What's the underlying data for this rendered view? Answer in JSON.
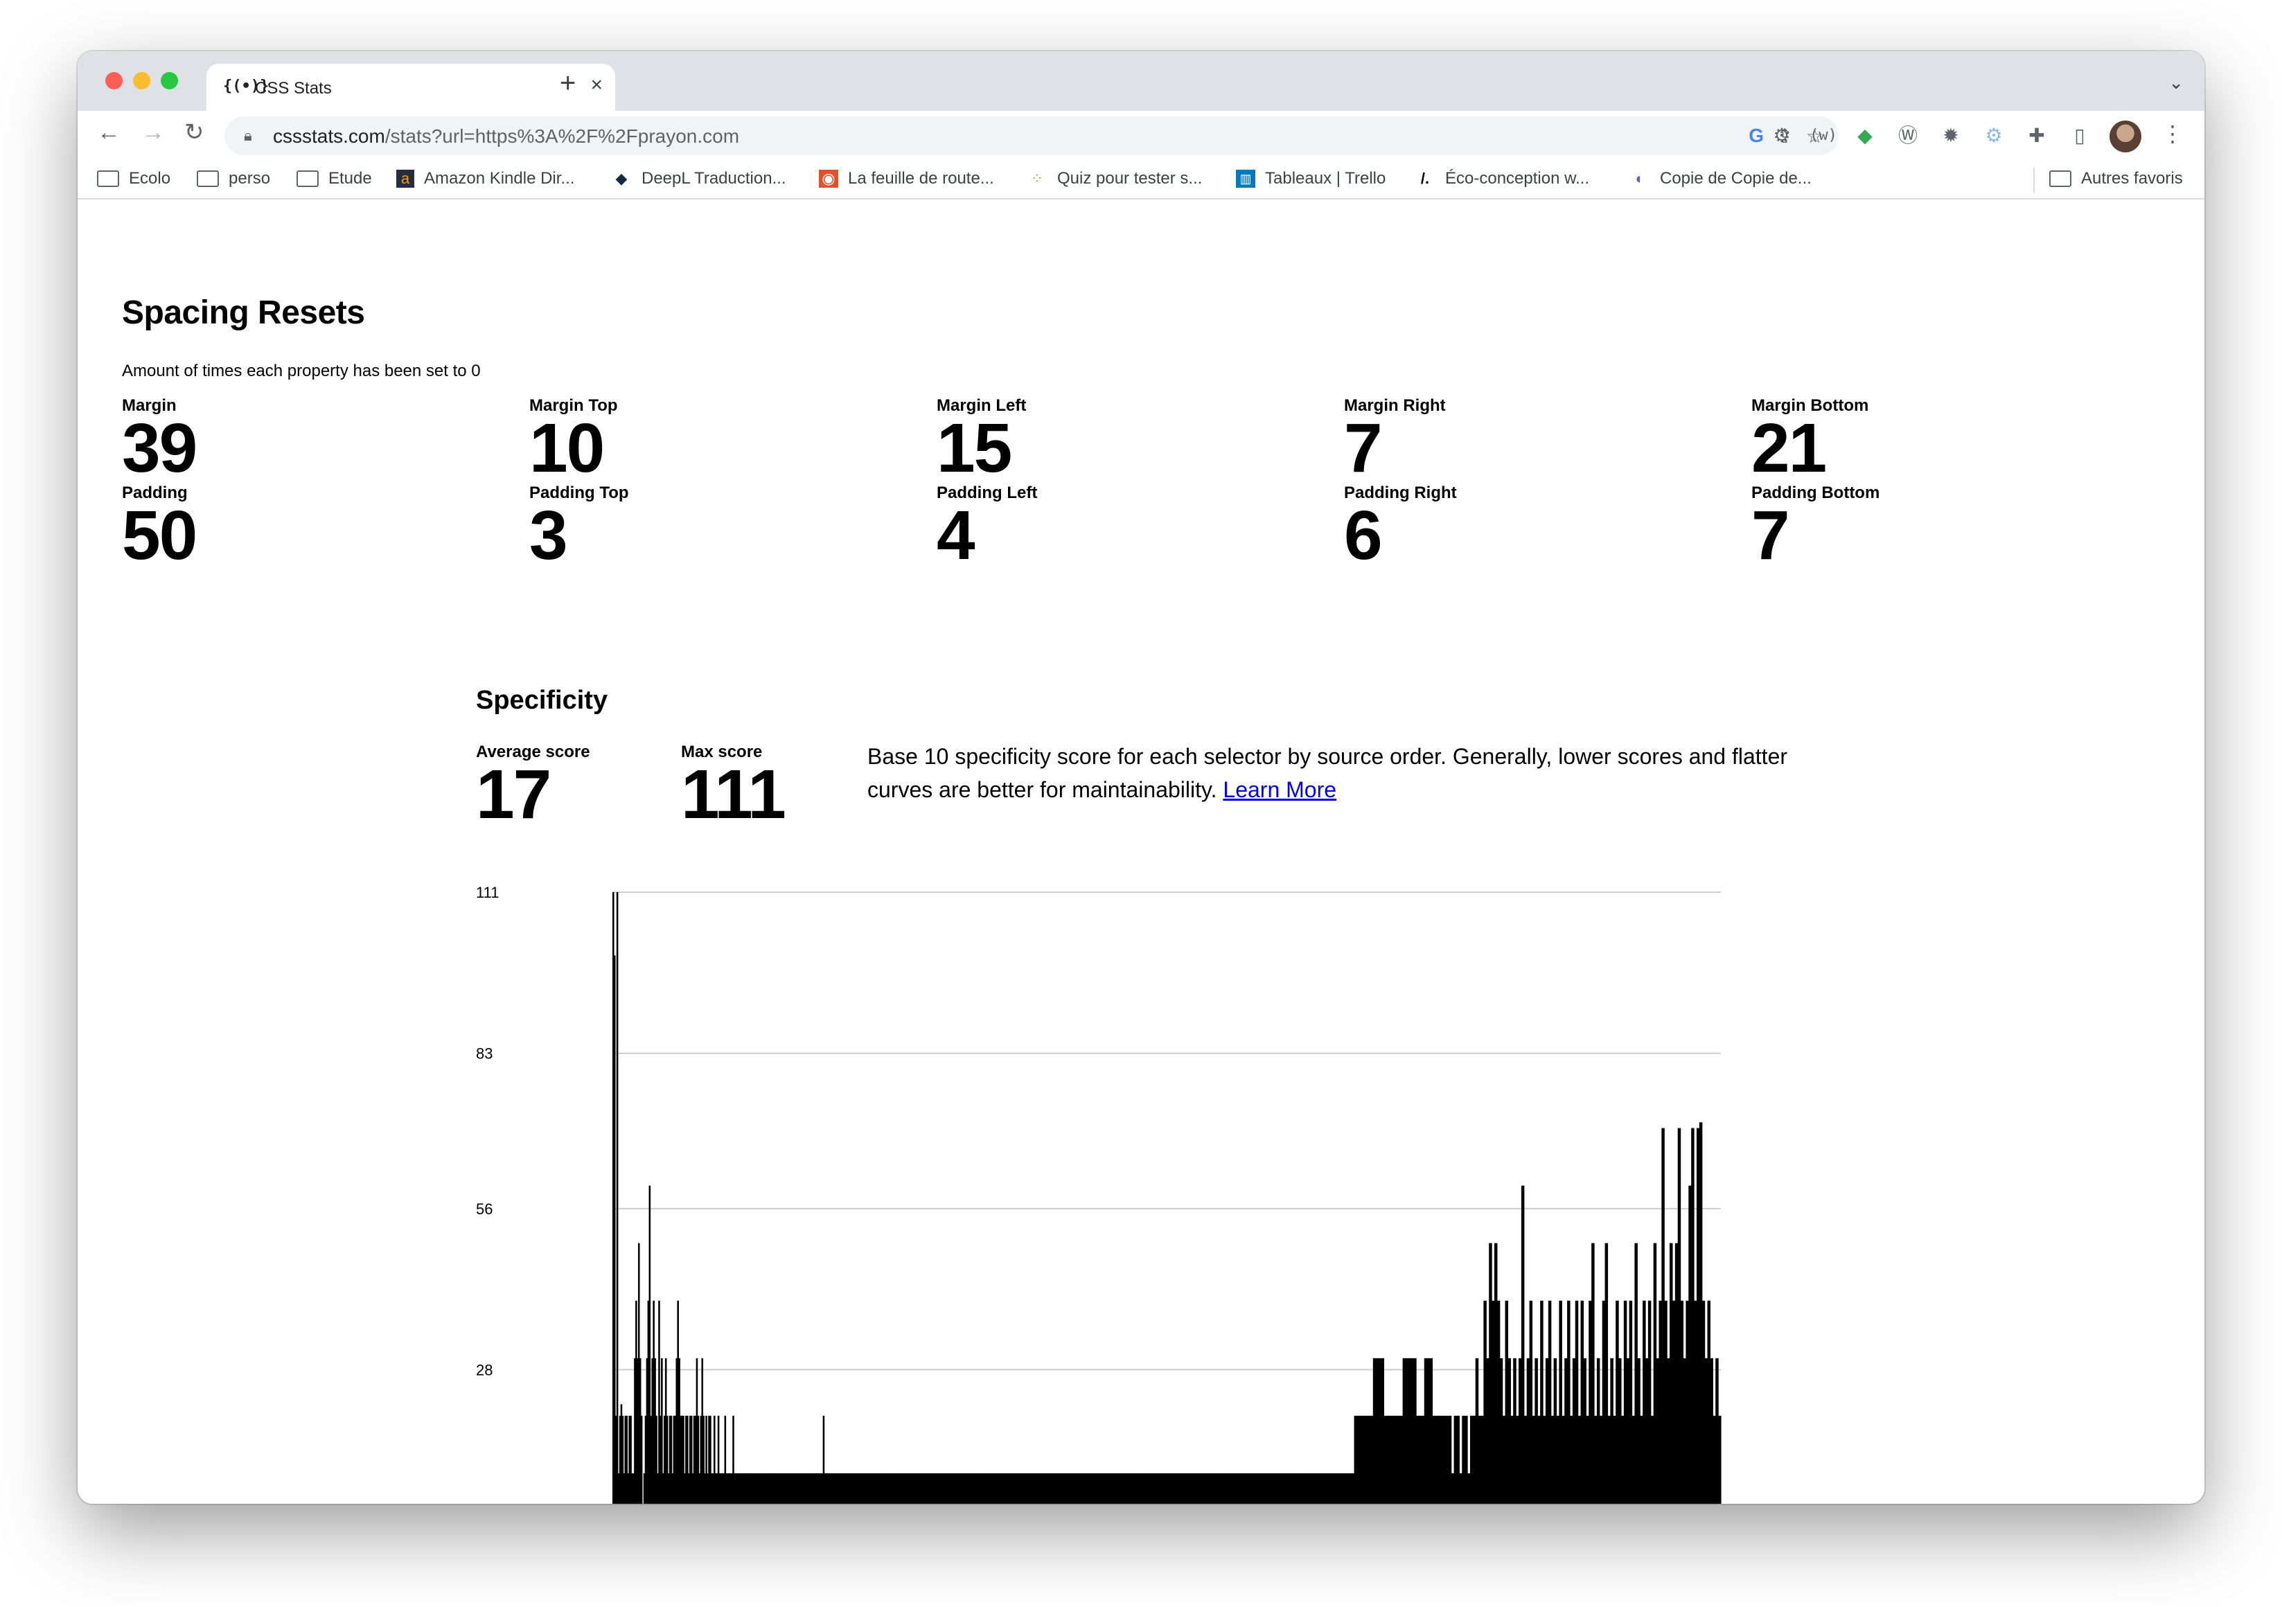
{
  "browser": {
    "tab_title": "CSS Stats",
    "tab_favicon": "{(•)}",
    "new_tab": "+",
    "url_host": "cssstats.com",
    "url_rest": "/stats?url=https%3A%2F%2Fprayon.com",
    "bookmarks": [
      "Ecolo",
      "perso",
      "Etude",
      "Amazon Kindle Dir...",
      "DeepL Traduction...",
      "La feuille de route...",
      "Quiz pour tester s...",
      "Tableaux | Trello",
      "Éco-conception w...",
      "Copie de Copie de..."
    ],
    "other_bookmarks": "Autres favoris"
  },
  "spacing": {
    "title": "Spacing Resets",
    "description": "Amount of times each property has been set to 0",
    "items": [
      {
        "label": "Margin",
        "value": "39"
      },
      {
        "label": "Margin Top",
        "value": "10"
      },
      {
        "label": "Margin Left",
        "value": "15"
      },
      {
        "label": "Margin Right",
        "value": "7"
      },
      {
        "label": "Margin Bottom",
        "value": "21"
      },
      {
        "label": "Padding",
        "value": "50"
      },
      {
        "label": "Padding Top",
        "value": "3"
      },
      {
        "label": "Padding Left",
        "value": "4"
      },
      {
        "label": "Padding Right",
        "value": "6"
      },
      {
        "label": "Padding Bottom",
        "value": "7"
      }
    ]
  },
  "specificity": {
    "title": "Specificity",
    "average_label": "Average score",
    "average_value": "17",
    "max_label": "Max score",
    "max_value": "111",
    "description": "Base 10 specificity score for each selector by source order. Generally, lower scores and flatter curves are better for maintainability.",
    "learn_more": "Learn More"
  },
  "chart_data": {
    "type": "bar",
    "title": "",
    "xlabel": "",
    "ylabel": "",
    "y_ticks": [
      28,
      56,
      83,
      111
    ],
    "ylim": [
      0,
      111
    ],
    "grid": true,
    "segments": [
      [
        1,
        111
      ],
      [
        1,
        100
      ],
      [
        1,
        20
      ],
      [
        1,
        111
      ],
      [
        1,
        10
      ],
      [
        1,
        20
      ],
      [
        1,
        22
      ],
      [
        1,
        20
      ],
      [
        1,
        10
      ],
      [
        1,
        20
      ],
      [
        1,
        20
      ],
      [
        1,
        10
      ],
      [
        1,
        20
      ],
      [
        1,
        20
      ],
      [
        2,
        10
      ],
      [
        1,
        30
      ],
      [
        1,
        40
      ],
      [
        1,
        30
      ],
      [
        1,
        50
      ],
      [
        1,
        30
      ],
      [
        1,
        20
      ],
      [
        1,
        0
      ],
      [
        1,
        10
      ],
      [
        1,
        20
      ],
      [
        1,
        30
      ],
      [
        1,
        40
      ],
      [
        1,
        60
      ],
      [
        1,
        20
      ],
      [
        1,
        30
      ],
      [
        1,
        40
      ],
      [
        1,
        30
      ],
      [
        1,
        20
      ],
      [
        1,
        10
      ],
      [
        1,
        40
      ],
      [
        1,
        20
      ],
      [
        1,
        30
      ],
      [
        1,
        10
      ],
      [
        1,
        20
      ],
      [
        1,
        30
      ],
      [
        1,
        20
      ],
      [
        1,
        10
      ],
      [
        1,
        20
      ],
      [
        1,
        20
      ],
      [
        1,
        10
      ],
      [
        1,
        20
      ],
      [
        1,
        20
      ],
      [
        1,
        30
      ],
      [
        1,
        40
      ],
      [
        1,
        30
      ],
      [
        1,
        20
      ],
      [
        1,
        20
      ],
      [
        1,
        20
      ],
      [
        1,
        10
      ],
      [
        1,
        20
      ],
      [
        1,
        20
      ],
      [
        1,
        10
      ],
      [
        1,
        20
      ],
      [
        1,
        20
      ],
      [
        1,
        10
      ],
      [
        1,
        20
      ],
      [
        1,
        20
      ],
      [
        1,
        30
      ],
      [
        1,
        20
      ],
      [
        1,
        10
      ],
      [
        1,
        20
      ],
      [
        1,
        30
      ],
      [
        1,
        20
      ],
      [
        1,
        10
      ],
      [
        1,
        20
      ],
      [
        1,
        10
      ],
      [
        1,
        20
      ],
      [
        1,
        20
      ],
      [
        1,
        10
      ],
      [
        1,
        10
      ],
      [
        1,
        20
      ],
      [
        1,
        10
      ],
      [
        1,
        10
      ],
      [
        1,
        20
      ],
      [
        2,
        10
      ],
      [
        1,
        10
      ],
      [
        1,
        10
      ],
      [
        1,
        20
      ],
      [
        1,
        10
      ],
      [
        1,
        10
      ],
      [
        3,
        10
      ],
      [
        1,
        20
      ],
      [
        3,
        10
      ],
      [
        1,
        10
      ],
      [
        3,
        10
      ],
      [
        1,
        10
      ],
      [
        5,
        10
      ],
      [
        3,
        10
      ],
      [
        10,
        10
      ],
      [
        5,
        10
      ],
      [
        20,
        10
      ],
      [
        10,
        10
      ],
      [
        5,
        10
      ],
      [
        1,
        20
      ],
      [
        3,
        10
      ],
      [
        20,
        10
      ],
      [
        30,
        10
      ],
      [
        60,
        10
      ],
      [
        60,
        10
      ],
      [
        60,
        10
      ],
      [
        60,
        10
      ],
      [
        60,
        10
      ],
      [
        40,
        10
      ],
      [
        8,
        20
      ],
      [
        6,
        20
      ],
      [
        8,
        30
      ],
      [
        6,
        20
      ],
      [
        8,
        20
      ],
      [
        10,
        30
      ],
      [
        6,
        20
      ],
      [
        6,
        30
      ],
      [
        8,
        20
      ],
      [
        6,
        20
      ],
      [
        2,
        10
      ],
      [
        4,
        20
      ],
      [
        2,
        10
      ],
      [
        4,
        20
      ],
      [
        2,
        10
      ],
      [
        4,
        20
      ],
      [
        2,
        30
      ],
      [
        4,
        20
      ],
      [
        2,
        40
      ],
      [
        2,
        30
      ],
      [
        2,
        50
      ],
      [
        2,
        40
      ],
      [
        2,
        50
      ],
      [
        2,
        40
      ],
      [
        2,
        30
      ],
      [
        2,
        20
      ],
      [
        2,
        40
      ],
      [
        2,
        30
      ],
      [
        2,
        20
      ],
      [
        2,
        30
      ],
      [
        2,
        20
      ],
      [
        2,
        30
      ],
      [
        2,
        60
      ],
      [
        2,
        20
      ],
      [
        2,
        30
      ],
      [
        2,
        40
      ],
      [
        2,
        20
      ],
      [
        2,
        30
      ],
      [
        2,
        20
      ],
      [
        2,
        40
      ],
      [
        2,
        20
      ],
      [
        2,
        30
      ],
      [
        2,
        40
      ],
      [
        2,
        20
      ],
      [
        2,
        30
      ],
      [
        2,
        20
      ],
      [
        2,
        40
      ],
      [
        2,
        20
      ],
      [
        2,
        30
      ],
      [
        2,
        40
      ],
      [
        2,
        20
      ],
      [
        2,
        30
      ],
      [
        2,
        40
      ],
      [
        2,
        20
      ],
      [
        2,
        40
      ],
      [
        2,
        30
      ],
      [
        2,
        20
      ],
      [
        2,
        40
      ],
      [
        2,
        50
      ],
      [
        2,
        20
      ],
      [
        2,
        30
      ],
      [
        2,
        20
      ],
      [
        2,
        40
      ],
      [
        2,
        50
      ],
      [
        2,
        20
      ],
      [
        2,
        30
      ],
      [
        2,
        20
      ],
      [
        2,
        40
      ],
      [
        2,
        30
      ],
      [
        2,
        20
      ],
      [
        2,
        40
      ],
      [
        2,
        30
      ],
      [
        2,
        40
      ],
      [
        2,
        20
      ],
      [
        2,
        50
      ],
      [
        2,
        30
      ],
      [
        2,
        20
      ],
      [
        2,
        40
      ],
      [
        2,
        30
      ],
      [
        2,
        40
      ],
      [
        2,
        20
      ],
      [
        2,
        50
      ],
      [
        2,
        30
      ],
      [
        2,
        40
      ],
      [
        2,
        70
      ],
      [
        2,
        40
      ],
      [
        2,
        30
      ],
      [
        2,
        50
      ],
      [
        2,
        40
      ],
      [
        2,
        50
      ],
      [
        2,
        70
      ],
      [
        2,
        40
      ],
      [
        2,
        30
      ],
      [
        2,
        40
      ],
      [
        2,
        60
      ],
      [
        2,
        70
      ],
      [
        2,
        40
      ],
      [
        2,
        70
      ],
      [
        2,
        71
      ],
      [
        2,
        40
      ],
      [
        2,
        30
      ],
      [
        2,
        40
      ],
      [
        2,
        30
      ],
      [
        2,
        20
      ],
      [
        2,
        30
      ],
      [
        2,
        20
      ]
    ]
  },
  "colors": {
    "bar": "#000000",
    "grid": "#cccccc",
    "link": "#0000ee",
    "tabstrip": "#dee1e6"
  }
}
